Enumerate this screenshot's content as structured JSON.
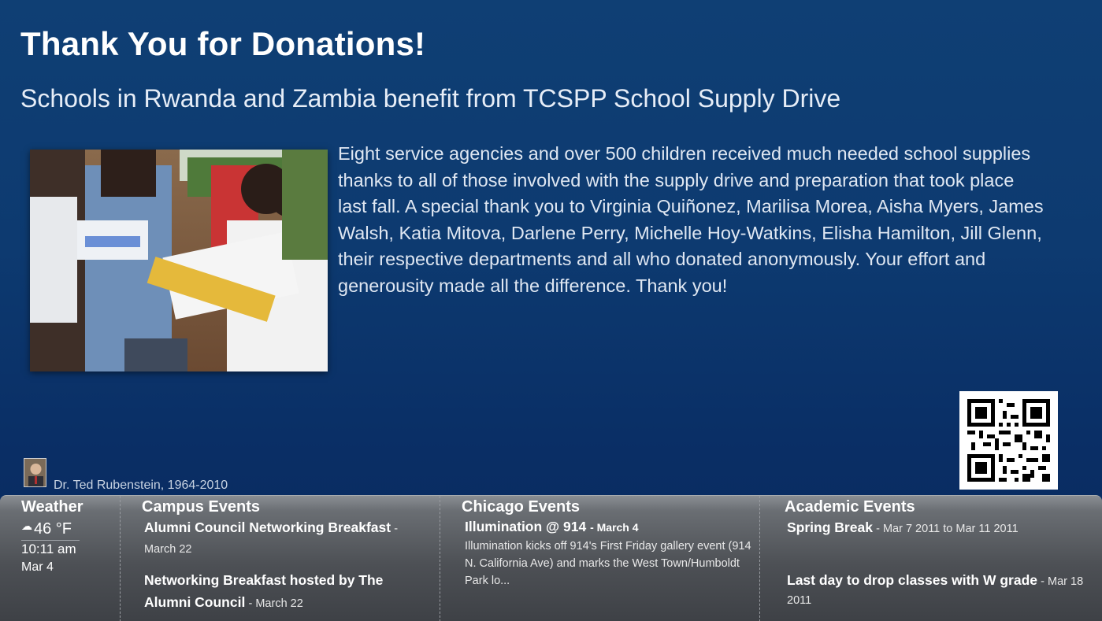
{
  "slide": {
    "headline": "Thank You for Donations!",
    "subheadline": "Schools in Rwanda and Zambia benefit from TCSPP School Supply Drive",
    "body": "Eight service agencies and over 500 children received much needed school supplies thanks to all of those involved with the supply drive and preparation that took place last fall. A special thank you to Virginia Quiñonez, Marilisa Morea, Aisha Myers, James Walsh, Katia Mitova, Darlene Perry, Michelle Hoy-Watkins, Elisha Hamilton, Jill Glenn, their respective departments and all who donated anonymously. Your effort and generousity made all the difference. Thank you!"
  },
  "memorial": {
    "text": "Dr. Ted Rubenstein, 1964-2010"
  },
  "ticker": {
    "weather": {
      "title": "Weather",
      "icon": "partly-cloudy-icon",
      "temperature": "46 °F",
      "time": "10:11 am",
      "date": "Mar 4"
    },
    "campus": {
      "title": "Campus Events",
      "events": [
        {
          "name": "Alumni Council Networking Breakfast",
          "date": "- March 22"
        },
        {
          "name": "Networking Breakfast hosted by The Alumni Council",
          "date": "- March 22"
        }
      ]
    },
    "chicago": {
      "title": "Chicago Events",
      "event_name": "Illumination @ 914",
      "event_date": "- March 4",
      "event_desc": "Illumination kicks off 914's First Friday gallery event (914 N. California Ave) and marks the West Town/Humboldt Park lo..."
    },
    "academic": {
      "title": "Academic Events",
      "events": [
        {
          "name": "Spring Break",
          "date": "- Mar 7 2011 to Mar 11 2011"
        },
        {
          "name": "Last day to drop classes with W grade",
          "date": "- Mar 18 2011"
        }
      ]
    }
  },
  "colors": {
    "background_top": "#0f3f74",
    "background_bottom": "#08285c",
    "ticker_gray": "#4d5055"
  }
}
